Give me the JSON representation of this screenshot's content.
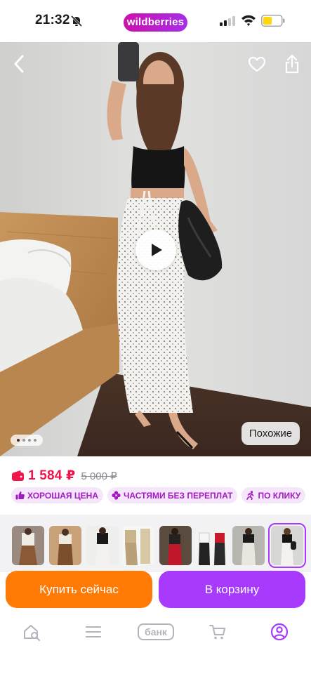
{
  "status_bar": {
    "time": "21:32",
    "brand": "wildberries"
  },
  "product": {
    "price": "1 584 ₽",
    "old_price": "5 000 ₽",
    "badges": [
      {
        "label": "ХОРОШАЯ ЦЕНА",
        "icon": "thumbs-up-icon"
      },
      {
        "label": "ЧАСТЯМИ БЕЗ ПЕРЕПЛАТ",
        "icon": "clover-icon"
      },
      {
        "label": "ПО КЛИКУ",
        "icon": "runner-icon"
      }
    ]
  },
  "gallery": {
    "similar_label": "Похожие",
    "page_count": 4,
    "active_page": 1
  },
  "thumbnails": {
    "count": 8,
    "selected_index": 7
  },
  "actions": {
    "buy_now": "Купить сейчас",
    "add_to_cart": "В корзину"
  },
  "tab_bar": {
    "items": [
      {
        "name": "home-search-icon"
      },
      {
        "name": "menu-icon"
      },
      {
        "name": "bank",
        "label": "банк"
      },
      {
        "name": "cart-icon"
      },
      {
        "name": "profile-icon"
      }
    ]
  },
  "colors": {
    "brand": "#cb11ab",
    "accent_purple": "#a73afd",
    "buy_orange": "#ff7b06",
    "price_red": "#f0154a",
    "badge_bg": "#f6e6fb"
  }
}
